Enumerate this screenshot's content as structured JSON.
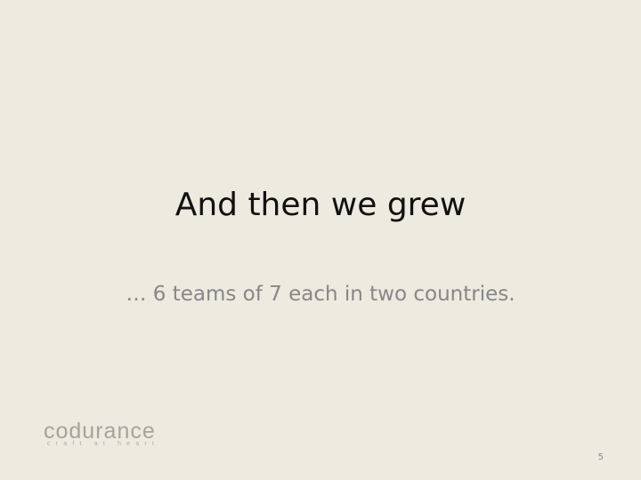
{
  "slide": {
    "title": "And then we grew",
    "subtitle": "… 6 teams of 7 each in two countries.",
    "page_number": "5"
  },
  "logo": {
    "wordmark": "codurance",
    "tagline": "craft at heart"
  },
  "colors": {
    "background": "#edeae0",
    "title": "#111111",
    "subtitle": "#878787",
    "logo_accent": "#c9a15a"
  }
}
